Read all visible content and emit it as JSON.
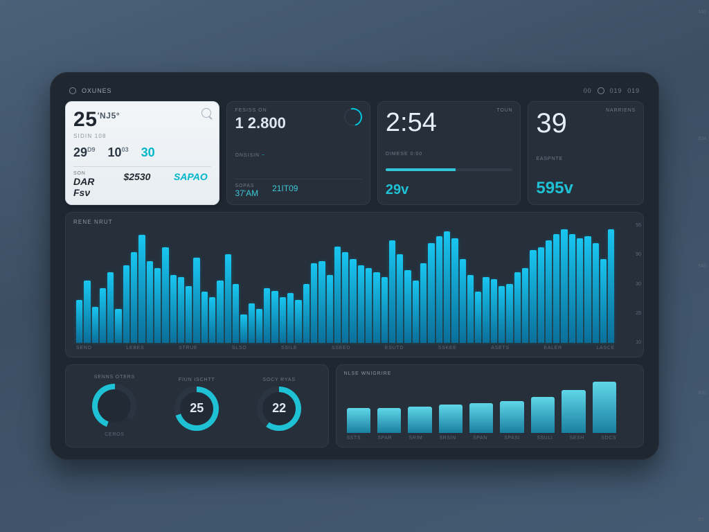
{
  "topbar": {
    "brand": "OXUNES",
    "nav": [
      "00",
      "",
      "019",
      "019"
    ]
  },
  "card_light": {
    "primary": "25",
    "primary_suffix": "'NJ5°",
    "primary_sub": "SIDIN 108",
    "mid": [
      {
        "v": "29",
        "sup": "D9"
      },
      {
        "v": "10",
        "sup": "03"
      },
      {
        "v": "30"
      }
    ],
    "bottom": [
      {
        "label": "SON",
        "value": "DAR Fѕν"
      },
      {
        "label": "",
        "value": "$2530"
      },
      {
        "label": "",
        "value": "SAPAO",
        "accent": true
      }
    ]
  },
  "card_session": {
    "label_top": "FESISS ON",
    "value_top": "1 2.800",
    "mid_label": "ONSISIN",
    "bottom": [
      {
        "label": "SOPAS",
        "value": "37'AM"
      },
      {
        "label": "",
        "value": "21IT09"
      }
    ]
  },
  "card_clock": {
    "time": "2:54",
    "label_right": "TOUN",
    "sub": "DIMESE 0:00",
    "bottom_value": "29v",
    "progress_pct": 55
  },
  "card_metric": {
    "value": "39",
    "label_right": "NARRIENS",
    "sub": "EASPNTE",
    "bottom_value": "595v"
  },
  "gauges": {
    "items": [
      {
        "label": "SENNS OTERS",
        "value": "",
        "sub": "CEROS",
        "pct": 45,
        "semi": true
      },
      {
        "label": "FIUN ISCHTT",
        "value": "25",
        "sub": "",
        "pct": 70
      },
      {
        "label": "SOCY RYAS",
        "value": "22",
        "sub": "",
        "pct": 60
      }
    ]
  },
  "chart_data": [
    {
      "type": "bar",
      "title": "RENE NRUT",
      "categories": [
        "SENO",
        "LEBES",
        "STRUE",
        "SLSO",
        "SSILE",
        "SSEED",
        "ESUTD",
        "SSKEE",
        "ASETS",
        "EALER",
        "LASCE"
      ],
      "values": [
        38,
        55,
        32,
        48,
        62,
        30,
        68,
        80,
        95,
        72,
        66,
        84,
        60,
        58,
        50,
        75,
        45,
        40,
        55,
        78,
        52,
        25,
        35,
        30,
        48,
        46,
        40,
        44,
        38,
        52,
        70,
        72,
        60,
        85,
        80,
        74,
        68,
        66,
        62,
        58,
        90,
        78,
        64,
        55,
        70,
        88,
        94,
        98,
        92,
        74,
        60,
        45,
        58,
        56,
        50,
        52,
        62,
        66,
        82,
        84,
        90,
        96,
        100,
        96,
        92,
        94,
        88,
        74,
        100
      ],
      "ylabels": [
        "55",
        "90",
        "30",
        "25",
        "10"
      ],
      "ylim": [
        0,
        100
      ]
    },
    {
      "type": "bar",
      "title": "NLSE WNIGRIRE",
      "categories": [
        "SSTS",
        "SPAR",
        "SRIM",
        "SRSIN",
        "SPAN",
        "SPASI",
        "SSULI",
        "SESH",
        "SDCS"
      ],
      "values": [
        48,
        48,
        52,
        55,
        58,
        62,
        70,
        84,
        100
      ],
      "ylabels": [
        "155",
        "534",
        "545",
        "530",
        "50"
      ],
      "ylim": [
        0,
        100
      ]
    }
  ]
}
